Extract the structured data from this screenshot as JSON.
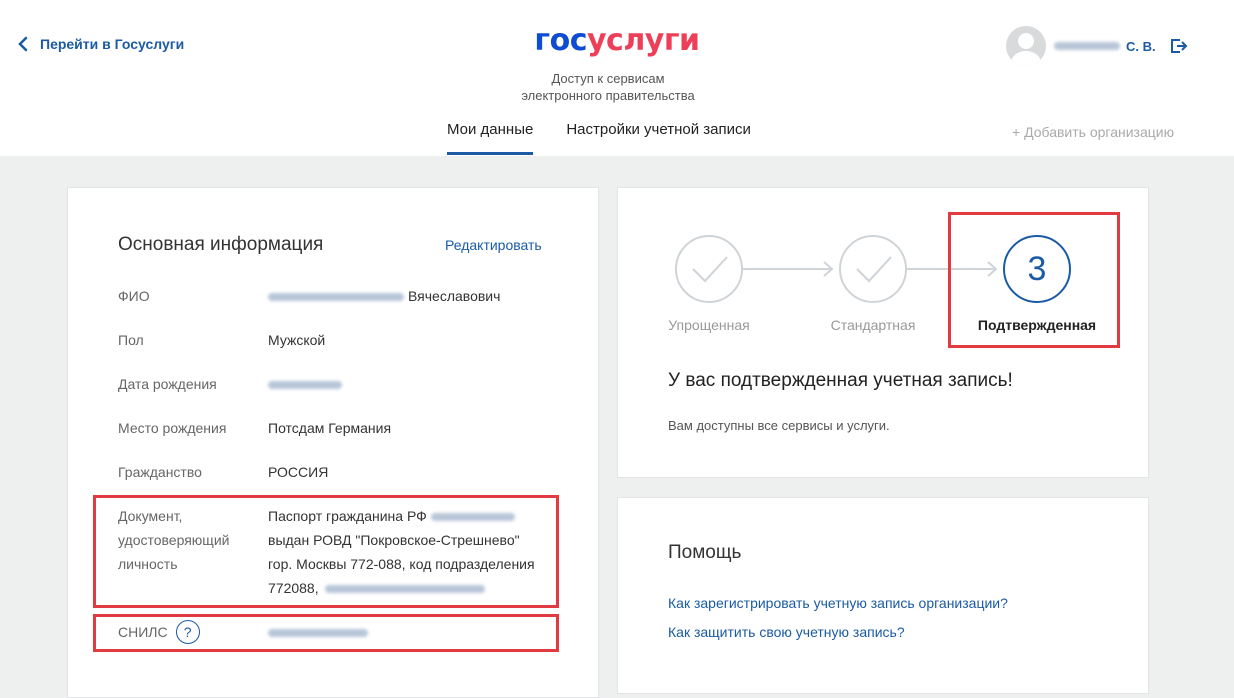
{
  "header": {
    "back_label": "Перейти в Госуслуги",
    "logo_part1": "гос",
    "logo_part2": "услуги",
    "subtitle_line1": "Доступ к сервисам",
    "subtitle_line2": "электронного правительства",
    "user_name": "С. В."
  },
  "tabs": [
    {
      "label": "Мои данные",
      "active": true
    },
    {
      "label": "Настройки учетной записи",
      "active": false
    }
  ],
  "add_org": "+ Добавить организацию",
  "main": {
    "title": "Основная информация",
    "edit_label": "Редактировать",
    "fio_label": "ФИО",
    "fio_value": "Вячеславович",
    "gender_label": "Пол",
    "gender_value": "Мужской",
    "birthdate_label": "Дата рождения",
    "birthplace_label": "Место рождения",
    "birthplace_value": "Потсдам Германия",
    "citizenship_label": "Гражданство",
    "citizenship_value": "РОССИЯ",
    "doc_label_line1": "Документ,",
    "doc_label_line2": "удостоверяющий",
    "doc_label_line3": "личность",
    "doc_line1": "Паспорт гражданина РФ",
    "doc_line2": "выдан РОВД \"Покровское-Стрешнево\"",
    "doc_line3": "гор. Москвы 772-088, код подразделения",
    "doc_line4": "772088,",
    "snils_label": "СНИЛС",
    "snils_help": "?"
  },
  "status": {
    "steps": [
      {
        "label": "Упрощенная",
        "done": true
      },
      {
        "label": "Стандартная",
        "done": true
      },
      {
        "label": "Подтвержденная",
        "number": "3",
        "current": true
      }
    ],
    "title": "У вас подтвержденная учетная запись!",
    "text": "Вам доступны все сервисы и услуги."
  },
  "help": {
    "title": "Помощь",
    "links": [
      "Как зарегистрировать учетную запись организации?",
      "Как защитить свою учетную запись?"
    ]
  },
  "colors": {
    "accent": "#1a5ba4",
    "logo_blue": "#0d4cd3",
    "logo_red": "#ee3f58",
    "highlight": "#e23a41"
  }
}
